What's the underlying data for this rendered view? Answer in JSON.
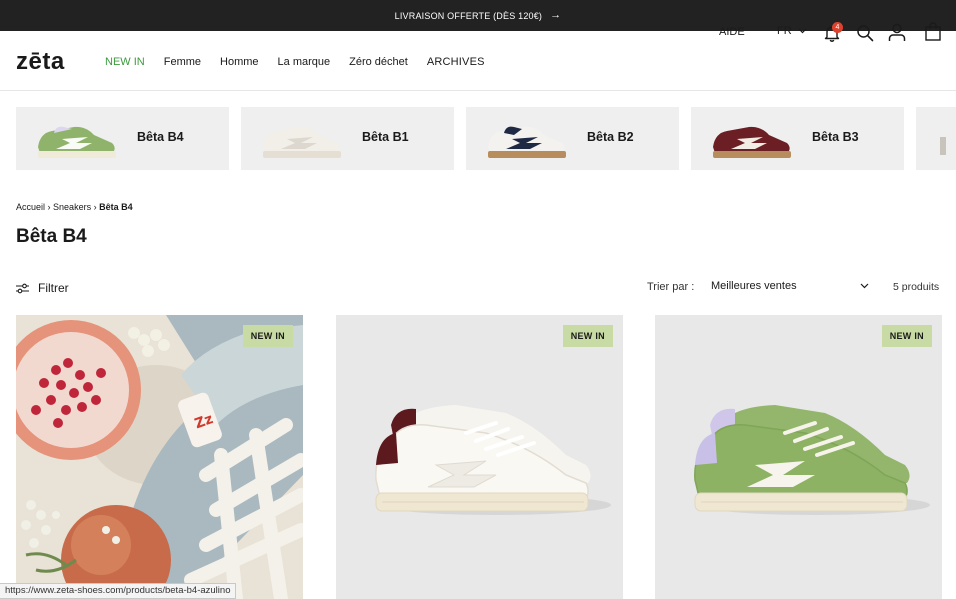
{
  "announcement": {
    "text": "LIVRAISON OFFERTE (DÈS 120€)",
    "arrow": "→"
  },
  "header": {
    "logo": "zēta",
    "nav": [
      "NEW IN",
      "Femme",
      "Homme",
      "La marque",
      "Zéro déchet",
      "ARCHIVES"
    ],
    "aide": "AIDE",
    "lang": "FR",
    "notifications_count": "4"
  },
  "collection": [
    {
      "name": "Bêta B4",
      "color": "#8fb36a"
    },
    {
      "name": "Bêta B1",
      "color": "#e9e6df"
    },
    {
      "name": "Bêta B2",
      "color": "#1e2a44"
    },
    {
      "name": "Bêta B3",
      "color": "#6b1f24"
    }
  ],
  "breadcrumb": {
    "home": "Accueil",
    "sep1": "›",
    "category": "Sneakers",
    "sep2": "›",
    "current": "Bêta B4"
  },
  "page_title": "Bêta B4",
  "toolbar": {
    "filter_label": "Filtrer",
    "sort_label": "Trier par :",
    "sort_value": "Meilleures ventes",
    "count": "5 produits"
  },
  "products": [
    {
      "badge": "NEW IN"
    },
    {
      "badge": "NEW IN"
    },
    {
      "badge": "NEW IN"
    }
  ],
  "status_url": "https://www.zeta-shoes.com/products/beta-b4-azulino",
  "colors": {
    "new_in_green": "#3d9a3d",
    "badge_bg": "#c8dba4",
    "notification_red": "#e0412b",
    "announce_bg": "#222222"
  }
}
